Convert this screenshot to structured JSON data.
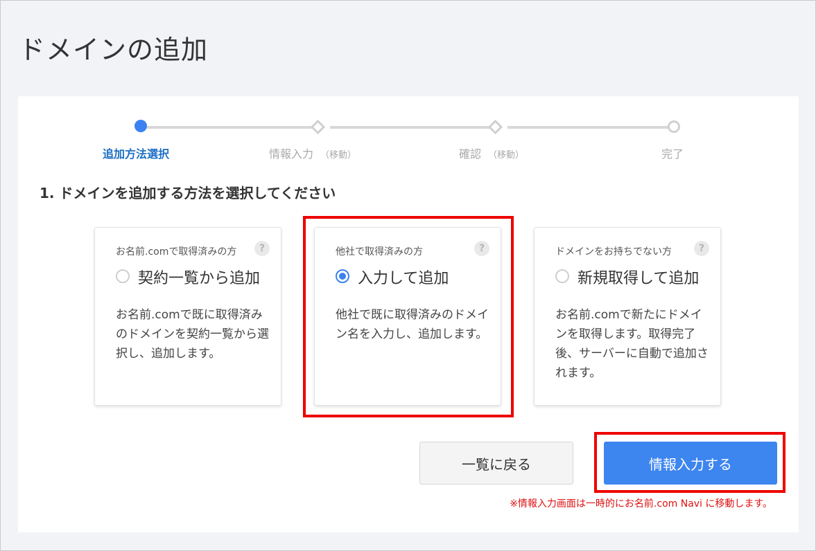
{
  "page": {
    "title": "ドメインの追加"
  },
  "stepper": {
    "steps": [
      {
        "label": "追加方法選択",
        "sub": "",
        "state": "active"
      },
      {
        "label": "情報入力",
        "sub": "（移動）",
        "state": "pending"
      },
      {
        "label": "確認",
        "sub": "（移動）",
        "state": "pending"
      },
      {
        "label": "完了",
        "sub": "",
        "state": "pending"
      }
    ]
  },
  "section": {
    "heading": "1. ドメインを追加する方法を選択してください"
  },
  "options": [
    {
      "subtitle": "お名前.comで取得済みの方",
      "label": "契約一覧から追加",
      "description": "お名前.comで既に取得済みのドメインを契約一覧から選択し、追加します。",
      "selected": false
    },
    {
      "subtitle": "他社で取得済みの方",
      "label": "入力して追加",
      "description": "他社で既に取得済みのドメイン名を入力し、追加します。",
      "selected": true
    },
    {
      "subtitle": "ドメインをお持ちでない方",
      "label": "新規取得して追加",
      "description": "お名前.comで新たにドメインを取得します。取得完了後、サーバーに自動で追加されます。",
      "selected": false
    }
  ],
  "help_glyph": "?",
  "buttons": {
    "back_label": "一覧に戻る",
    "next_label": "情報入力する"
  },
  "note": "※情報入力画面は一時的にお名前.com Navi に移動します。",
  "colors": {
    "accent": "#3d85ef",
    "highlight": "#ee0000",
    "note": "#dd1111"
  }
}
